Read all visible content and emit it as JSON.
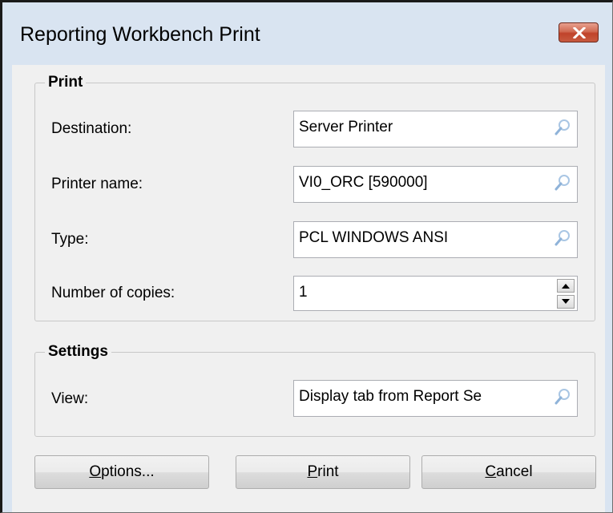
{
  "window": {
    "title": "Reporting Workbench Print"
  },
  "print_group": {
    "legend": "Print",
    "fields": [
      {
        "label": "Destination:",
        "value": "Server Printer",
        "icon": "magnifier-icon"
      },
      {
        "label": "Printer name:",
        "value": "VI0_ORC [590000]",
        "icon": "magnifier-icon"
      },
      {
        "label": "Type:",
        "value": "PCL WINDOWS ANSI",
        "icon": "magnifier-icon"
      }
    ],
    "copies": {
      "label": "Number of copies:",
      "value": "1"
    }
  },
  "settings_group": {
    "legend": "Settings",
    "view": {
      "label": "View:",
      "value": "Display tab from Report Se",
      "icon": "magnifier-icon"
    }
  },
  "buttons": {
    "options": {
      "mnemonic": "O",
      "rest": "ptions..."
    },
    "print": {
      "mnemonic": "P",
      "rest": "rint"
    },
    "cancel": {
      "mnemonic": "C",
      "rest": "ancel"
    }
  },
  "colors": {
    "title_bg": "#d9e4f1",
    "client_bg": "#f0f0f0",
    "close_button": "#c0432a"
  }
}
